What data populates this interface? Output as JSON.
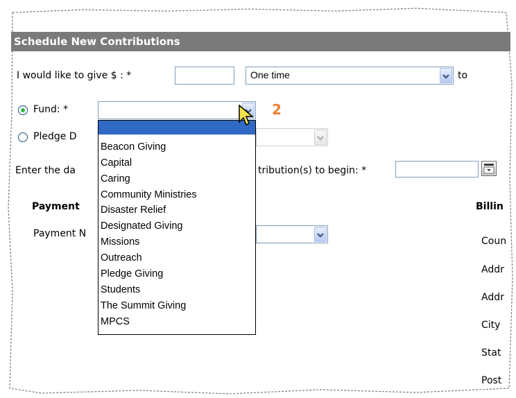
{
  "form": {
    "title": "Schedule New Contributions",
    "give_label": "I would like to give $ : *",
    "amount_value": "",
    "frequency_value": "One time",
    "to_label": "to",
    "fund_label": "Fund: *",
    "pledge_label": "Pledge D",
    "date_label_left": "Enter the da",
    "date_label_right": "tribution(s) to begin: *",
    "step_badge": "2"
  },
  "fund_dropdown": {
    "selected": "",
    "options": [
      "Beacon Giving",
      "Capital",
      "Caring",
      "Community Ministries",
      "Disaster Relief",
      "Designated Giving",
      "Missions",
      "Outreach",
      "Pledge Giving",
      "Students",
      "The Summit Giving",
      "MPCS"
    ]
  },
  "payment": {
    "heading": "Payment",
    "method_label": "Payment N"
  },
  "billing": {
    "heading": "Billin",
    "fields": [
      "Coun",
      "Addr",
      "Addr",
      "City",
      "Stat",
      "Post"
    ]
  },
  "colors": {
    "header_bg": "#7a7a7a",
    "selection": "#316ac5",
    "badge": "#f08030",
    "radio_on": "#2dbb3a"
  }
}
